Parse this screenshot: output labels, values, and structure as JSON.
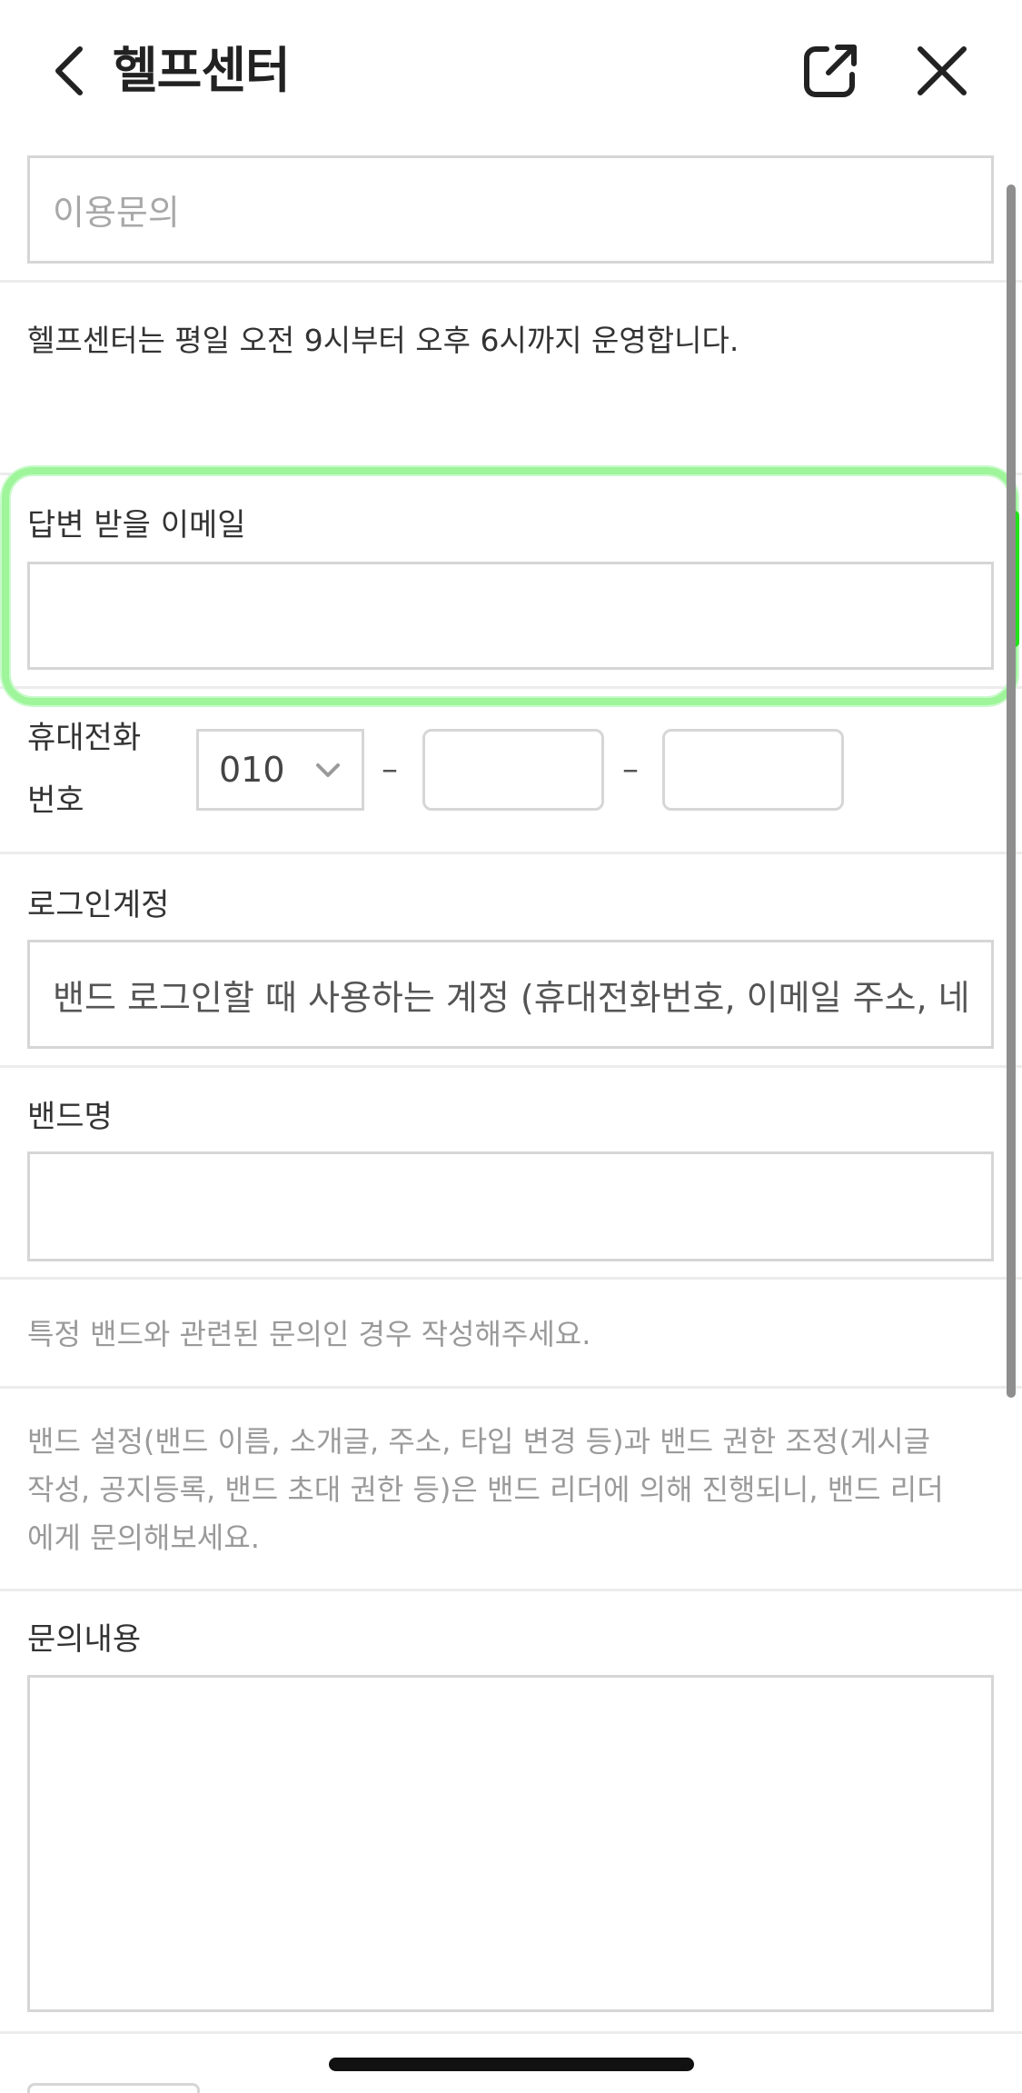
{
  "header": {
    "title": "헬프센터",
    "back_icon": "chevron-left-icon",
    "share_icon": "external-link-icon",
    "close_icon": "close-icon"
  },
  "category": {
    "placeholder": "이용문의"
  },
  "notice": "헬프센터는 평일 오전 9시부터 오후 6시까지 운영합니다.",
  "email": {
    "label": "답변 받을 이메일",
    "value": ""
  },
  "phone": {
    "label_line1": "휴대전화",
    "label_line2": "번호",
    "prefix": "010",
    "separator": "–",
    "middle": "",
    "last": ""
  },
  "login_account": {
    "label": "로그인계정",
    "placeholder": "밴드 로그인할 때 사용하는 계정 (휴대전화번호, 이메일 주소, 네"
  },
  "band_name": {
    "label": "밴드명",
    "value": "",
    "hint": "특정 밴드와 관련된 문의인 경우 작성해주세요."
  },
  "info_text": {
    "line1": "밴드 설정(밴드 이름, 소개글, 주소, 타입 변경 등)과 밴드 권한 조정(게시글",
    "line2": "작성, 공지등록, 밴드 초대 권한 등)은 밴드 리더에 의해 진행되니, 밴드 리더",
    "line3": "에게 문의해보세요."
  },
  "inquiry": {
    "label": "문의내용",
    "value": ""
  },
  "colors": {
    "highlight": "#9ef59a",
    "border": "#d6d6d6",
    "placeholder": "#a8a8a8"
  }
}
